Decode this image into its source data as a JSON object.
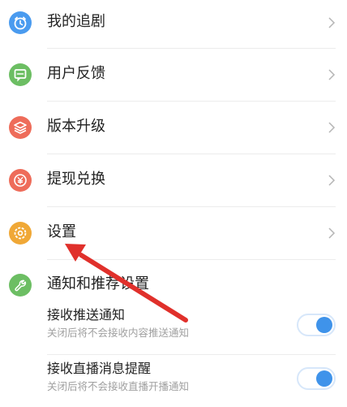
{
  "menu": {
    "items": [
      {
        "label": "我的追剧",
        "icon": "alarm-clock-icon",
        "color": "#4a9bef"
      },
      {
        "label": "用户反馈",
        "icon": "feedback-icon",
        "color": "#6cbe63"
      },
      {
        "label": "版本升级",
        "icon": "layers-icon",
        "color": "#ee6c5a"
      },
      {
        "label": "提现兑换",
        "icon": "yuan-icon",
        "color": "#ee6c5a"
      },
      {
        "label": "设置",
        "icon": "gear-icon",
        "color": "#f0a836"
      }
    ]
  },
  "notifications": {
    "title": "通知和推荐设置",
    "icon": "wrench-icon",
    "color": "#6cbe63",
    "toggles": [
      {
        "title": "接收推送通知",
        "description": "关闭后将不会接收内容推送通知",
        "on": true
      },
      {
        "title": "接收直播消息提醒",
        "description": "关闭后将不会接收直播开播通知",
        "on": true
      }
    ]
  },
  "colors": {
    "toggle_on": "#3f93ea",
    "arrow": "#e0302b"
  }
}
